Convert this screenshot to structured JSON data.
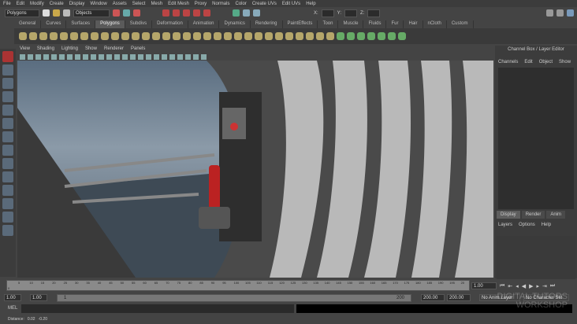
{
  "menu": [
    "File",
    "Edit",
    "Modify",
    "Create",
    "Display",
    "Window",
    "Assets",
    "Select",
    "Mesh",
    "Edit Mesh",
    "Proxy",
    "Normals",
    "Color",
    "Create UVs",
    "Edit UVs",
    "Help"
  ],
  "status": {
    "menu_set": "Polygons",
    "selection_mode": "Objects",
    "x_label": "X:",
    "y_label": "Y:",
    "z_label": "Z:"
  },
  "shelf_tabs": [
    "General",
    "Curves",
    "Surfaces",
    "Polygons",
    "Subdivs",
    "Deformation",
    "Animation",
    "Dynamics",
    "Rendering",
    "PaintEffects",
    "Toon",
    "Muscle",
    "Fluids",
    "Fur",
    "Hair",
    "nCloth",
    "Custom"
  ],
  "active_shelf": "Polygons",
  "panel_menu": [
    "View",
    "Shading",
    "Lighting",
    "Show",
    "Renderer",
    "Panels"
  ],
  "channel_box": {
    "title": "Channel Box / Layer Editor",
    "menu": [
      "Channels",
      "Edit",
      "Object",
      "Show"
    ]
  },
  "layer_editor": {
    "tabs": [
      "Display",
      "Render",
      "Anim"
    ],
    "menu": [
      "Layers",
      "Options",
      "Help"
    ]
  },
  "timeline": {
    "ticks": [
      "5",
      "10",
      "15",
      "20",
      "25",
      "30",
      "35",
      "40",
      "45",
      "50",
      "55",
      "60",
      "65",
      "70",
      "75",
      "80",
      "85",
      "90",
      "95",
      "100",
      "105",
      "110",
      "115",
      "120",
      "125",
      "130",
      "135",
      "140",
      "145",
      "150",
      "155",
      "160",
      "165",
      "170",
      "175",
      "180",
      "185",
      "190",
      "195",
      "20"
    ],
    "start_tick": "0",
    "current_time": "1.00"
  },
  "range": {
    "start": "1.00",
    "playback_start": "1.00",
    "slider_start": "1",
    "slider_end": "200",
    "playback_end": "200.00",
    "end": "200.00",
    "anim_layer": "No Anim Layer",
    "character_set": "No Character Set"
  },
  "command": {
    "label": "MEL"
  },
  "help_line": {
    "label": "Distance:",
    "v1": "0.02",
    "v2": "-0.20"
  },
  "watermark": "DIGITAL TUTORS WORKSHOP"
}
